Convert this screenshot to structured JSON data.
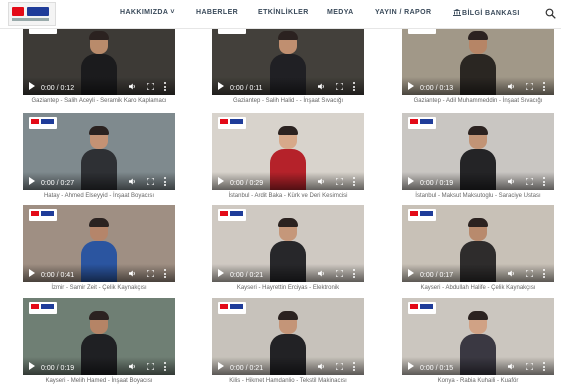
{
  "header": {
    "nav": [
      {
        "label": "HAKKIMIZDA ˅"
      },
      {
        "label": "HABERLER"
      },
      {
        "label": "ETKİNLİKLER"
      },
      {
        "label": "MEDYA"
      },
      {
        "label": "YAYIN / RAPOR"
      },
      {
        "label": "BİLGİ BANKASI"
      }
    ]
  },
  "videos": [
    {
      "time": "0:00 / 0:12",
      "caption": "Gaziantep - Salih Aceyli - Seramik Karo Kaplamacı",
      "bg": "#3d3a36",
      "body": "#1b1b1d",
      "skin": "#b98b6b"
    },
    {
      "time": "0:00 / 0:11",
      "caption": "Gaziantep - Salih Halid - - İnşaat Sıvacığı",
      "bg": "#43403b",
      "body": "#202024",
      "skin": "#c08f70"
    },
    {
      "time": "0:00 / 0:13",
      "caption": "Gaziantep - Adil Muhammeddin - İnşaat Sıvacığı",
      "bg": "#a19888",
      "body": "#2a2622",
      "skin": "#b68566"
    },
    {
      "time": "0:00 / 0:27",
      "caption": "Hatay - Ahmed Elseyyid - İnşaat Boyacısı",
      "bg": "#7f8a8e",
      "body": "#2e3034",
      "skin": "#c49274"
    },
    {
      "time": "0:00 / 0:29",
      "caption": "İstanbul - Ardit Baka - Kürk ve Deri Kesimcisi",
      "bg": "#d8d3cc",
      "body": "#b5222a",
      "skin": "#d7a98a"
    },
    {
      "time": "0:00 / 0:19",
      "caption": "İstanbul - Maksut Maksutoglu - Saraciye Ustası",
      "bg": "#c9c6c2",
      "body": "#242426",
      "skin": "#c29476"
    },
    {
      "time": "0:00 / 0:41",
      "caption": "İzmir - Samir Zeit - Çelik Kaynakçısı",
      "bg": "#9f8f83",
      "body": "#2b55a0",
      "skin": "#b5856a"
    },
    {
      "time": "0:00 / 0:21",
      "caption": "Kayseri - Hayrettin Erciyas - Elektronik",
      "bg": "#cfc9c2",
      "body": "#27272a",
      "skin": "#c5977a"
    },
    {
      "time": "0:00 / 0:17",
      "caption": "Kayseri - Abdullah Halife - Çelik Kaynakçısı",
      "bg": "#c8c1b7",
      "body": "#2e2c2c",
      "skin": "#b88a6d"
    },
    {
      "time": "0:00 / 0:19",
      "caption": "Kayseri - Melih Hamed - İnşaat Boyacısı",
      "bg": "#6f7f74",
      "body": "#1f2023",
      "skin": "#b58466"
    },
    {
      "time": "0:00 / 0:21",
      "caption": "Kilis - Hikmet Hamdanlio - Tekstil Makinacısı",
      "bg": "#c7c2bb",
      "body": "#222225",
      "skin": "#c49578"
    },
    {
      "time": "0:00 / 0:15",
      "caption": "Konya - Rabia Kuhaili - Kuaför",
      "bg": "#cbc6bf",
      "body": "#3a3842",
      "skin": "#d0a285"
    }
  ]
}
